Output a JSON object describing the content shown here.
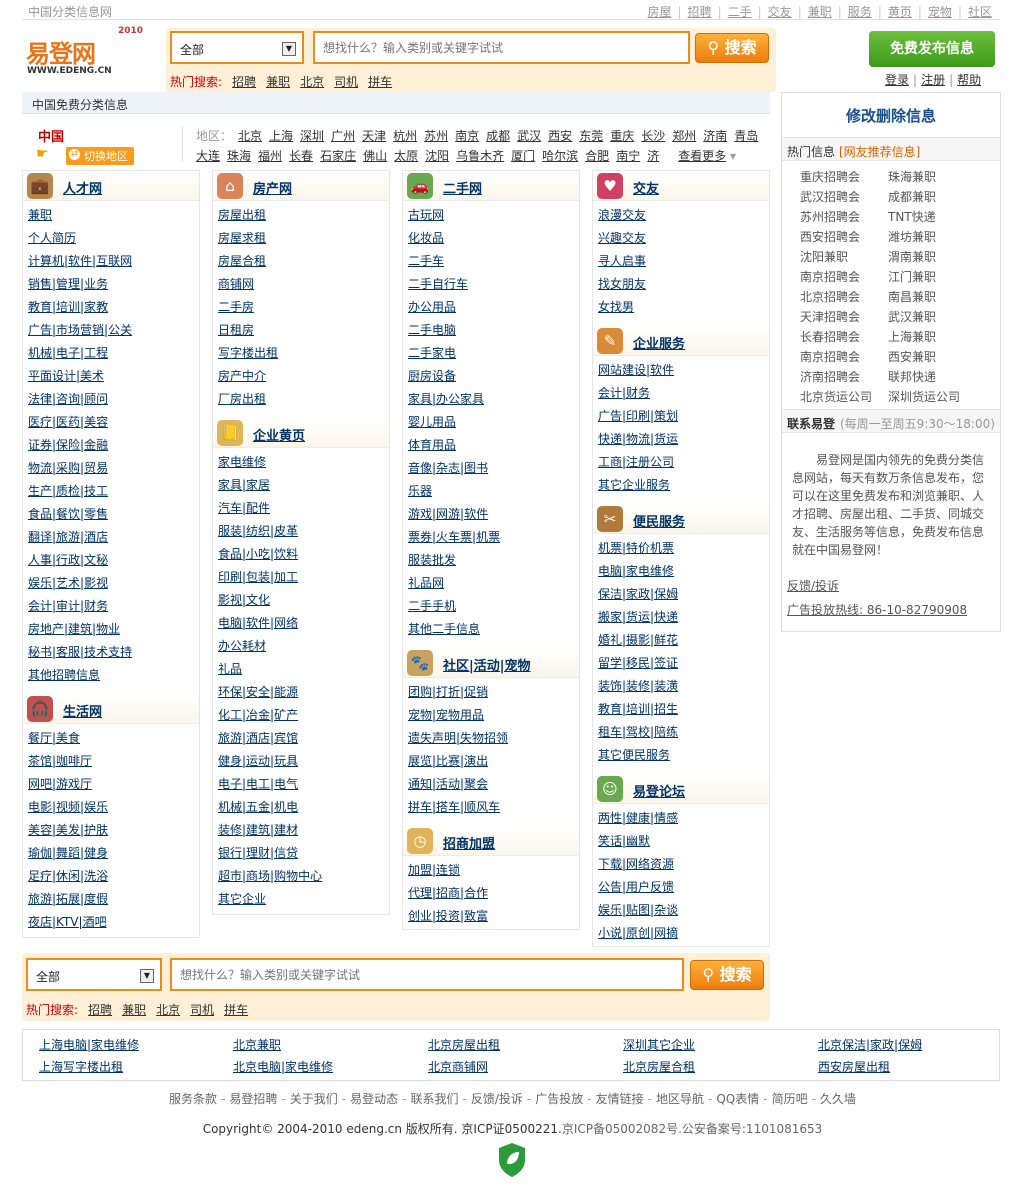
{
  "topbar": {
    "site_title": "中国分类信息网",
    "nav": [
      "房屋",
      "招聘",
      "二手",
      "交友",
      "兼职",
      "服务",
      "黄页",
      "宠物",
      "社区"
    ]
  },
  "header": {
    "logo_text": "易登网",
    "logo_url_text": "WWW.EDENG.CN",
    "logo_year": "2010",
    "search": {
      "category": "全部",
      "placeholder": "想找什么？输入类别或关键字试试",
      "button": "搜索",
      "hot_label": "热门搜索:",
      "hot_keywords": [
        "招聘",
        "兼职",
        "北京",
        "司机",
        "拼车"
      ]
    },
    "publish_button": "免费发布信息",
    "user_links": [
      "登录",
      "注册",
      "帮助"
    ]
  },
  "region": {
    "breadcrumb": "中国免费分类信息",
    "current": "中国",
    "switch_label": "切换地区",
    "area_label": "地区：",
    "cities_row1": [
      "北京",
      "上海",
      "深圳",
      "广州",
      "天津",
      "杭州",
      "苏州",
      "南京",
      "成都",
      "武汉",
      "西安",
      "东莞",
      "重庆",
      "长沙",
      "郑州",
      "济南",
      "青岛"
    ],
    "cities_row2": [
      "大连",
      "珠海",
      "福州",
      "长春",
      "石家庄",
      "佛山",
      "太原",
      "沈阳",
      "乌鲁木齐",
      "厦门",
      "哈尔滨",
      "合肥",
      "南宁",
      "济"
    ],
    "more": "查看更多"
  },
  "sections": {
    "jobs": {
      "title": "人才网",
      "icon": "briefcase-icon",
      "items": [
        "兼职",
        "个人简历",
        "计算机|软件|互联网",
        "销售|管理|业务",
        "教育|培训|家教",
        "广告|市场营销|公关",
        "机械|电子|工程",
        "平面设计|美术",
        "法律|咨询|顾问",
        "医疗|医药|美容",
        "证券|保险|金融",
        "物流|采购|贸易",
        "生产|质检|技工",
        "食品|餐饮|零售",
        "翻译|旅游|酒店",
        "人事|行政|文秘",
        "娱乐|艺术|影视",
        "会计|审计|财务",
        "房地产|建筑|物业",
        "秘书|客服|技术支持",
        "其他招聘信息"
      ]
    },
    "life": {
      "title": "生活网",
      "icon": "headphones-icon",
      "items": [
        "餐厅|美食",
        "茶馆|咖啡厅",
        "网吧|游戏厅",
        "电影|视频|娱乐",
        "美容|美发|护肤",
        "瑜伽|舞蹈|健身",
        "足疗|休闲|洗浴",
        "旅游|拓展|度假",
        "夜店|KTV|酒吧"
      ]
    },
    "house": {
      "title": "房产网",
      "icon": "house-icon",
      "items": [
        "房屋出租",
        "房屋求租",
        "房屋合租",
        "商铺网",
        "二手房",
        "日租房",
        "写字楼出租",
        "房产中介",
        "厂房出租"
      ]
    },
    "yellow": {
      "title": "企业黄页",
      "icon": "book-icon",
      "items": [
        "家电维修",
        "家具|家居",
        "汽车|配件",
        "服装|纺织|皮革",
        "食品|小吃|饮料",
        "印刷|包装|加工",
        "影视|文化",
        "电脑|软件|网络",
        "办公耗材",
        "礼品",
        "环保|安全|能源",
        "化工|冶金|矿产",
        "旅游|酒店|宾馆",
        "健身|运动|玩具",
        "电子|电工|电气",
        "机械|五金|机电",
        "装修|建筑|建材",
        "银行|理财|信贷",
        "超市|商场|购物中心",
        "其它企业"
      ]
    },
    "second": {
      "title": "二手网",
      "icon": "car-icon",
      "items": [
        "古玩网",
        "化妆品",
        "二手车",
        "二手自行车",
        "办公用品",
        "二手电脑",
        "二手家电",
        "厨房设备",
        "家具|办公家具",
        "婴儿用品",
        "体育用品",
        "音像|杂志|图书",
        "乐器",
        "游戏|网游|软件",
        "票券|火车票|机票",
        "服装批发",
        "礼品网",
        "二手手机",
        "其他二手信息"
      ]
    },
    "community": {
      "title": "社区|活动|宠物",
      "icon": "pet-icon",
      "items": [
        "团购|打折|促销",
        "宠物|宠物用品",
        "遗失声明|失物招领",
        "展览|比赛|演出",
        "通知|活动|聚会",
        "拼车|搭车|顺风车"
      ]
    },
    "franchise": {
      "title": "招商加盟",
      "icon": "clock-icon",
      "items": [
        "加盟|连锁",
        "代理|招商|合作",
        "创业|投资|致富"
      ]
    },
    "dating": {
      "title": "交友",
      "icon": "heart-icon",
      "items": [
        "浪漫交友",
        "兴趣交友",
        "寻人启事",
        "找女朋友",
        "女找男"
      ]
    },
    "business": {
      "title": "企业服务",
      "icon": "notepad-icon",
      "items": [
        "网站建设|软件",
        "会计|财务",
        "广告|印刷|策划",
        "快递|物流|货运",
        "工商|注册公司",
        "其它企业服务"
      ]
    },
    "service": {
      "title": "便民服务",
      "icon": "tools-icon",
      "items": [
        "机票|特价机票",
        "电脑|家电维修",
        "保洁|家政|保姆",
        "搬家|货运|快递",
        "婚礼|摄影|鲜花",
        "留学|移民|签证",
        "装饰|装修|装潢",
        "教育|培训|招生",
        "租车|驾校|陪练",
        "其它便民服务"
      ]
    },
    "forum": {
      "title": "易登论坛",
      "icon": "users-icon",
      "items": [
        "两性|健康|情感",
        "笑话|幽默",
        "下载|网络资源",
        "公告|用户反馈",
        "娱乐|贴图|杂谈",
        "小说|原创|网摘"
      ]
    }
  },
  "sidebar": {
    "modify_title": "修改删除信息",
    "hot_tab": "热门信息",
    "hot_tab_sub": "[网友推荐信息]",
    "hot_rows": [
      [
        "重庆招聘会",
        "珠海兼职"
      ],
      [
        "武汉招聘会",
        "成都兼职"
      ],
      [
        "苏州招聘会",
        "TNT快递"
      ],
      [
        "西安招聘会",
        "潍坊兼职"
      ],
      [
        "沈阳兼职",
        "渭南兼职"
      ],
      [
        "南京招聘会",
        "江门兼职"
      ],
      [
        "北京招聘会",
        "南昌兼职"
      ],
      [
        "天津招聘会",
        "武汉兼职"
      ],
      [
        "长春招聘会",
        "上海兼职"
      ],
      [
        "南京招聘会",
        "西安兼职"
      ],
      [
        "济南招聘会",
        "联邦快递"
      ],
      [
        "北京货运公司",
        "深圳货运公司"
      ]
    ],
    "contact_tab": "联系易登",
    "contact_hours": "(每周一至周五9:30～18:00)",
    "about": "易登网是国内领先的免费分类信息网站，每天有数万条信息发布，您可以在这里免费发布和浏览兼职、人才招聘、房屋出租、二手货、同城交友、生活服务等信息，免费发布信息就在中国易登网！",
    "feedback": "反馈/投诉",
    "ad_hotline": "广告投放热线: 86-10-82790908"
  },
  "friend_links": {
    "row1": [
      "上海电脑|家电维修",
      "北京兼职",
      "北京房屋出租",
      "深圳其它企业",
      "北京保洁|家政|保姆"
    ],
    "row2": [
      "上海写字楼出租",
      "北京电脑|家电维修",
      "北京商铺网",
      "北京房屋合租",
      "西安房屋出租"
    ]
  },
  "footer": {
    "links": [
      "服务条款",
      "易登招聘",
      "关于我们",
      "易登动态",
      "联系我们",
      "反馈/投诉",
      "广告投放",
      "友情链接",
      "地区导航",
      "QQ表情",
      "简历吧",
      "久久墙"
    ],
    "copyright": "Copyright© 2004-2010 edeng.cn 版权所有. 京ICP证0500221.",
    "icp": "京ICP备05002082号.公安备案号:1101081653"
  },
  "colors": {
    "accent": "#e88c1c",
    "link": "#003366",
    "hot": "#cc0000",
    "publish": "#4aa323"
  }
}
